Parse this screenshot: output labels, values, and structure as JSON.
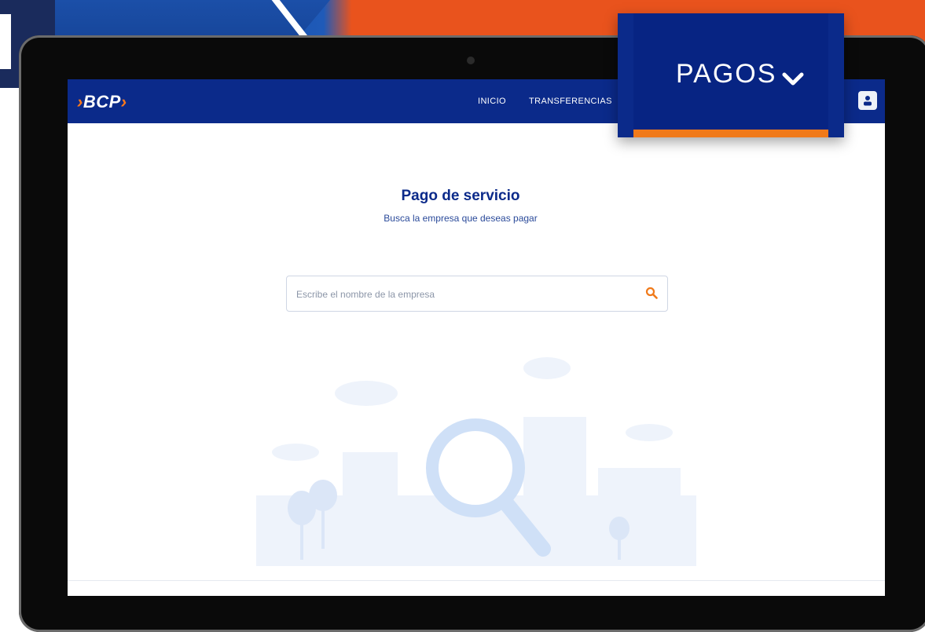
{
  "colors": {
    "brand_blue": "#0b2a8a",
    "accent_orange": "#f07a1a",
    "banner_orange": "#e9531d"
  },
  "logo": {
    "text": "BCP",
    "left_chevron": "›",
    "right_chevron": "›"
  },
  "navbar": {
    "links": [
      {
        "label": "INICIO"
      },
      {
        "label": "TRANSFERENCIAS"
      }
    ],
    "avatar_icon": "user-icon"
  },
  "callout": {
    "label": "PAGOS",
    "icon": "chevron-down-icon"
  },
  "main": {
    "title": "Pago de servicio",
    "subtitle": "Busca la empresa que deseas pagar"
  },
  "search": {
    "placeholder": "Escribe el nombre de la empresa",
    "value": "",
    "icon": "search-icon"
  },
  "illustration": {
    "icon": "magnifier-city-illustration"
  }
}
